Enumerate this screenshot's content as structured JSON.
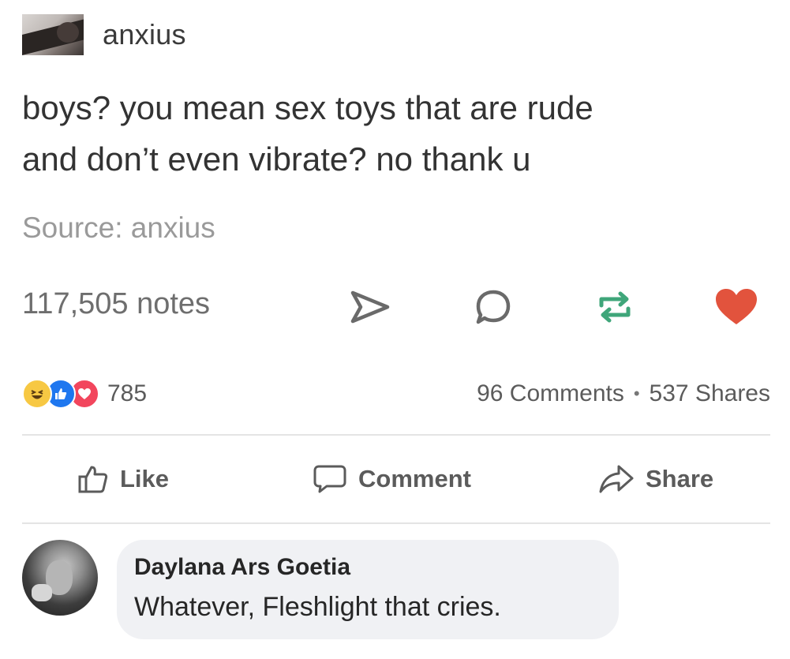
{
  "tumblr_post": {
    "username": "anxius",
    "body_line1": "boys? you mean sex toys that are rude",
    "body_line2": "and don’t even vibrate? no thank u",
    "source": "Source: anxius",
    "notes": "117,505 notes",
    "actions": [
      "send-icon",
      "reply-icon",
      "reblog-icon",
      "heart-icon"
    ],
    "heart_color": "#e2533d",
    "icon_color": "#6a6a6a",
    "reblog_color": "#3fa67a"
  },
  "facebook": {
    "reaction_icons": [
      "haha-reaction-icon",
      "like-reaction-icon",
      "love-reaction-icon"
    ],
    "reaction_count": "785",
    "comments_count": "96 Comments",
    "shares_count": "537 Shares",
    "buttons": {
      "like": "Like",
      "comment": "Comment",
      "share": "Share"
    },
    "comment": {
      "author": "Daylana Ars Goetia",
      "text": "Whatever, Fleshlight that cries."
    },
    "colors": {
      "like_blue": "#1f77ef",
      "love_red": "#f2465d",
      "haha_yellow": "#f7c843",
      "bubble_bg": "#f0f1f4"
    }
  }
}
